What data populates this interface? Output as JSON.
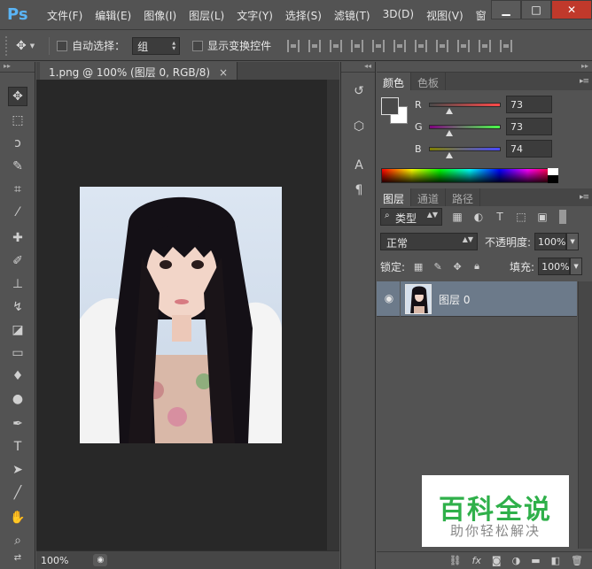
{
  "app": {
    "logo": "Ps",
    "menu": [
      "文件(F)",
      "编辑(E)",
      "图像(I)",
      "图层(L)",
      "文字(Y)",
      "选择(S)",
      "滤镜(T)",
      "3D(D)",
      "视图(V)",
      "窗"
    ],
    "window_controls": [
      "▁",
      "□",
      "✕"
    ]
  },
  "options_bar": {
    "auto_select_label": "自动选择：",
    "auto_select_value": "组",
    "show_transform_label": "显示变换控件"
  },
  "document": {
    "tab_title": "1.png @ 100% (图层 0, RGB/8)",
    "tab_close": "×",
    "zoom": "100%"
  },
  "color_panel": {
    "tabs": [
      "颜色",
      "色板"
    ],
    "foreground": "#494949",
    "background": "#ffffff",
    "channels": [
      {
        "label": "R",
        "value": "73",
        "fraction": 0.286
      },
      {
        "label": "G",
        "value": "73",
        "fraction": 0.286
      },
      {
        "label": "B",
        "value": "74",
        "fraction": 0.29
      }
    ]
  },
  "layers_panel": {
    "tabs": [
      "图层",
      "通道",
      "路径"
    ],
    "filter_kind": "类型",
    "blend_mode": "正常",
    "opacity_label": "不透明度:",
    "opacity_value": "100%",
    "lock_label": "锁定:",
    "fill_label": "填充:",
    "fill_value": "100%",
    "layers": [
      {
        "name": "图层 0",
        "visible": true
      }
    ],
    "footer_icons": [
      "link-icon",
      "fx-icon",
      "mask-icon",
      "adjustment-icon",
      "folder-icon",
      "new-layer-icon",
      "trash-icon"
    ]
  },
  "watermark": {
    "title": "百科全说",
    "subtitle": "助你轻松解决"
  }
}
